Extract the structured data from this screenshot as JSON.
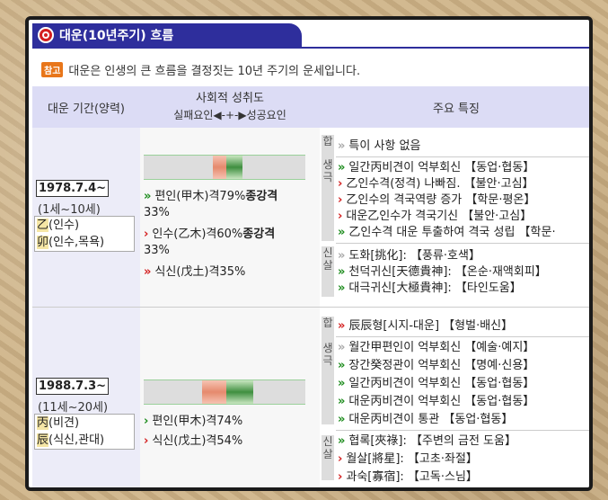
{
  "header": {
    "title": "대운(10년주기) 흐름"
  },
  "note": {
    "badge": "참고",
    "text": "대운은 인생의 큰 흐름을 결정짓는 10년 주기의 운세입니다."
  },
  "table": {
    "headers": {
      "period": "대운 기간(양력)",
      "social_title": "사회적 성취도",
      "social_scale": "실패요인◀-+-▶성공요인",
      "features": "주요 특징"
    },
    "rows": [
      {
        "date": "1978.7.4~",
        "age": "(1세~10세)",
        "pillar1_char": "乙",
        "pillar1_desc": "(인수)",
        "pillar2_char": "卯",
        "pillar2_desc": "(인수,목욕)",
        "bar": {
          "red_start": 0.43,
          "red_end": 0.51,
          "green_start": 0.51,
          "green_end": 0.61
        },
        "social": [
          {
            "chev": "green",
            "text": "편인(甲木)격79%",
            "strong": "종강격",
            "line2": "33%"
          },
          {
            "chev": "red",
            "text": "인수(乙木)격60%",
            "strong": "종강격",
            "line2": "33%"
          },
          {
            "chev": "red",
            "text": "식신(戊土)격35%",
            "strong": "",
            "line2": ""
          }
        ],
        "sections": [
          {
            "label": "합",
            "items": [
              {
                "chev": "gray",
                "text": "특이 사항 없음"
              }
            ]
          },
          {
            "label": "생극",
            "items": [
              {
                "chev": "green",
                "text": "일간丙비견이 억부회신 【동업·협동】"
              },
              {
                "chev": "red",
                "text": "乙인수격(정격) 나빠짐. 【불안·고심】"
              },
              {
                "chev": "red",
                "text": "乙인수의 격국역량 증가 【학문·평온】"
              },
              {
                "chev": "red",
                "text": "대운乙인수가 격국기신 【불안·고심】"
              },
              {
                "chev": "red",
                "text": "乙인수격 대운 투출하여 격국 성립 【학문·"
              }
            ]
          },
          {
            "label": "신살",
            "items": [
              {
                "chev": "gray",
                "text": "도화[挑化]: 【풍류·호색】"
              },
              {
                "chev": "green",
                "text": "천덕귀신[天德貴神]: 【온순·재액회피】"
              },
              {
                "chev": "green",
                "text": "대극귀신[大極貴神]: 【타인도움】"
              }
            ]
          }
        ]
      },
      {
        "date": "1988.7.3~",
        "age": "(11세~20세)",
        "pillar1_char": "丙",
        "pillar1_desc": "(비견)",
        "pillar2_char": "辰",
        "pillar2_desc": "(식신,관대)",
        "bar": {
          "red_start": 0.36,
          "red_end": 0.51,
          "green_start": 0.51,
          "green_end": 0.68
        },
        "social": [
          {
            "chev": "green",
            "text": "편인(甲木)격74%",
            "strong": "",
            "line2": ""
          },
          {
            "chev": "red",
            "text": "식신(戊土)격54%",
            "strong": "",
            "line2": ""
          }
        ],
        "sections": [
          {
            "label": "합",
            "items": [
              {
                "chev": "red",
                "text": "辰辰형[시지-대운] 【형벌·배신】"
              }
            ]
          },
          {
            "label": "생극",
            "items": [
              {
                "chev": "gray",
                "text": "월간甲편인이 억부회신 【예술·예지】"
              },
              {
                "chev": "green",
                "text": "장간癸정관이 억부회신 【명예·신용】"
              },
              {
                "chev": "green",
                "text": "일간丙비견이 억부회신 【동업·협동】"
              },
              {
                "chev": "green",
                "text": "대운丙비견이 억부회신 【동업·협동】"
              },
              {
                "chev": "green",
                "text": "대운丙비견이 통관 【동업·협동】"
              }
            ]
          },
          {
            "label": "신살",
            "items": [
              {
                "chev": "green",
                "text": "협록[夾祿]: 【주변의 금전 도움】"
              },
              {
                "chev": "red",
                "text": "월살[將星]: 【고초·좌절】"
              },
              {
                "chev": "red",
                "text": "과숙[寡宿]: 【고독·스님】"
              }
            ]
          }
        ]
      }
    ]
  }
}
